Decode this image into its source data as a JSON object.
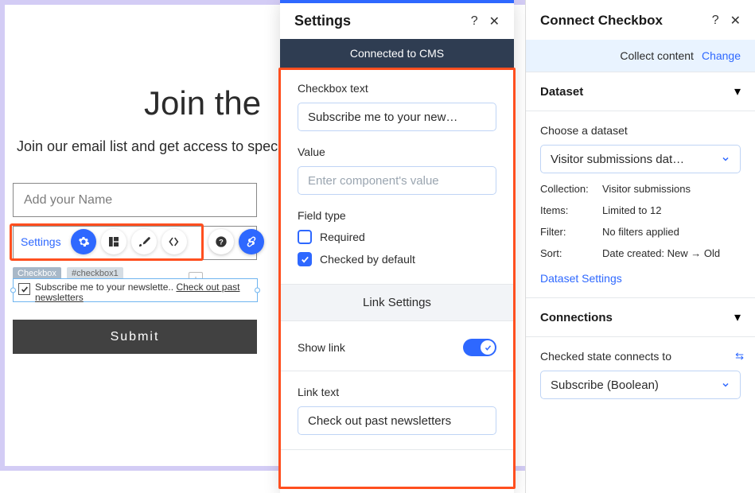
{
  "canvas": {
    "title": "Join the",
    "subtitle": "Join our email list and get access to specia",
    "name_placeholder": "Add your Name",
    "settings_btn": "Settings",
    "checkbox_tag": "Checkbox",
    "checkbox_id": "#checkbox1",
    "checkbox_text_a": "Subscribe me to your newslette",
    "checkbox_text_b": "Check out past newsletters",
    "submit": "Submit",
    "anchor_glyph": "↓"
  },
  "settings": {
    "title": "Settings",
    "cms_banner": "Connected to CMS",
    "checkbox_text_label": "Checkbox text",
    "checkbox_text_value": "Subscribe me to your new…",
    "value_label": "Value",
    "value_placeholder": "Enter component's value",
    "field_type_label": "Field type",
    "required_label": "Required",
    "checked_default_label": "Checked by default",
    "link_settings": "Link Settings",
    "show_link_label": "Show link",
    "link_text_label": "Link text",
    "link_text_value": "Check out past newsletters"
  },
  "connect": {
    "title": "Connect Checkbox",
    "collect_label": "Collect content",
    "change": "Change",
    "dataset_section": "Dataset",
    "choose_dataset_label": "Choose a dataset",
    "dataset_value": "Visitor submissions dat…",
    "collection_label": "Collection:",
    "collection_value": "Visitor submissions",
    "items_label": "Items:",
    "items_value": "Limited to 12",
    "filter_label": "Filter:",
    "filter_value": "No filters applied",
    "sort_label": "Sort:",
    "sort_value": "Date created: New → Old",
    "dataset_settings": "Dataset Settings",
    "connections_section": "Connections",
    "checked_state_label": "Checked state connects to",
    "checked_state_value": "Subscribe (Boolean)"
  }
}
